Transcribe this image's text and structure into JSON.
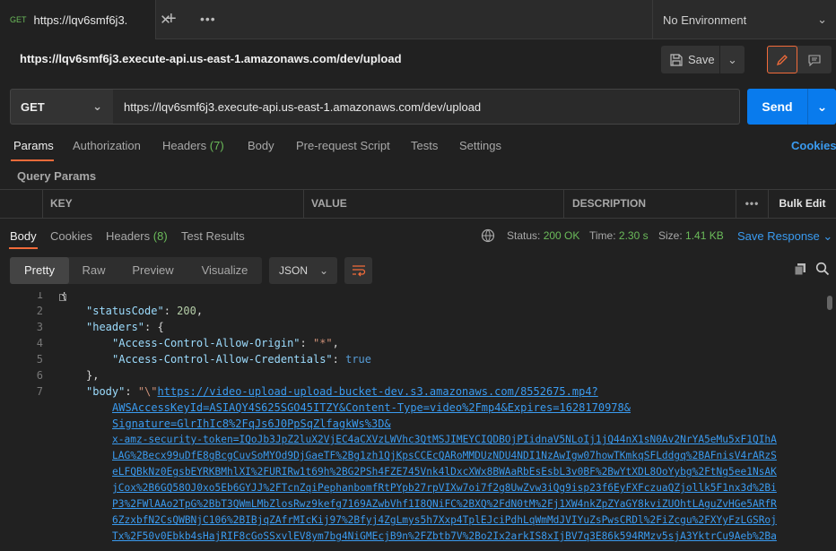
{
  "tab": {
    "method": "GET",
    "title": "https://lqv6smf6j3."
  },
  "environment": {
    "label": "No Environment"
  },
  "request": {
    "title": "https://lqv6smf6j3.execute-api.us-east-1.amazonaws.com/dev/upload",
    "method": "GET",
    "url": "https://lqv6smf6j3.execute-api.us-east-1.amazonaws.com/dev/upload",
    "save_label": "Save",
    "send_label": "Send"
  },
  "request_tabs": {
    "params": "Params",
    "authorization": "Authorization",
    "headers": "Headers",
    "headers_count": "(7)",
    "body": "Body",
    "prerequest": "Pre-request Script",
    "tests": "Tests",
    "settings": "Settings",
    "cookies": "Cookies"
  },
  "query_params": {
    "title": "Query Params",
    "col_key": "KEY",
    "col_value": "VALUE",
    "col_description": "DESCRIPTION",
    "bulk_edit": "Bulk Edit"
  },
  "response": {
    "tabs": {
      "body": "Body",
      "cookies": "Cookies",
      "headers": "Headers",
      "headers_count": "(8)",
      "test_results": "Test Results"
    },
    "status_label": "Status:",
    "status_value": "200 OK",
    "time_label": "Time:",
    "time_value": "2.30 s",
    "size_label": "Size:",
    "size_value": "1.41 KB",
    "save_response": "Save Response"
  },
  "format": {
    "pretty": "Pretty",
    "raw": "Raw",
    "preview": "Preview",
    "visualize": "Visualize",
    "language": "JSON"
  },
  "code": {
    "line_numbers": [
      "1",
      "2",
      "3",
      "4",
      "5",
      "6",
      "7"
    ],
    "status_key": "\"statusCode\"",
    "status_val": "200",
    "headers_key": "\"headers\"",
    "acao_key": "\"Access-Control-Allow-Origin\"",
    "acao_val": "\"*\"",
    "acac_key": "\"Access-Control-Allow-Credentials\"",
    "acac_val": "true",
    "body_key": "\"body\"",
    "body_quote": "\"\\\"",
    "body_lines": [
      "https://video-upload-upload-bucket-dev.s3.amazonaws.com/8552675.mp4?",
      "AWSAccessKeyId=ASIAQY4S625SGO45ITZY&Content-Type=video%2Fmp4&Expires=1628170978&",
      "Signature=GlrIhIc8%2FqJs6J0PpSqZlfagkWs%3D&",
      "x-amz-security-token=IQoJb3JpZ2luX2VjEC4aCXVzLWVhc3QtMSJIMEYCIQDBOjPIidnaV5NLoIj1jQ44nX1sN0Av2NrYA5eMu5xF1QIhA",
      "LAG%2Becx99uDfE8gBcgCuvSoMYOd9DjGaeTF%2Bg1zh1QjKpsCCEcQARoMMDUzNDU4NDI1NzAwIgw07howTKmkqSFLddgq%2BAFnisV4rARzS",
      "eLFQBkNz0EgsbEYRKBMhlXI%2FURIRw1t69h%2BG2PSh4FZE745Vnk4lDxcXWx8BWAaRbEsEsbL3v0BF%2BwYtXDL8OoYybg%2FtNg5ee1NsAK",
      "jCox%2B6GQ58OJ0xo5Eb6GYJJ%2FTcnZqiPephanbomfRtPYpb27rpVIXw7oi7f2g8UwZvw3iQg9isp23f6EyFXFczuaQZjollk5F1nx3d%2Bi",
      "P3%2FWlAAo2TpG%2BbT3QWmLMbZlosRwz9kefg7169AZwbVhf1I8QNiFC%2BXQ%2FdN0tM%2Fj1XW4nkZpZYaGY8kviZUOhtLAguZvHGe5ARfR",
      "6ZzxbfN2CsQWBNjC106%2BIBjqZAfrMIcKij97%2Bfyj4ZgLmys5h7Xxp4TplEJciPdhLqWmMdJVIYuZsPwsCRDl%2FiZcgu%2FXYyFzLGSRoj",
      "Tx%2F50v0Ebkb4sHajRIF8cGoSSxvlEV8ym7bg4NiGMEcjB9n%2FZbtb7V%2Bo2Ix2arkIS8xIjBV7q3E86k594RMzv5sjA3YktrCu9Aeb%2Ba"
    ]
  }
}
